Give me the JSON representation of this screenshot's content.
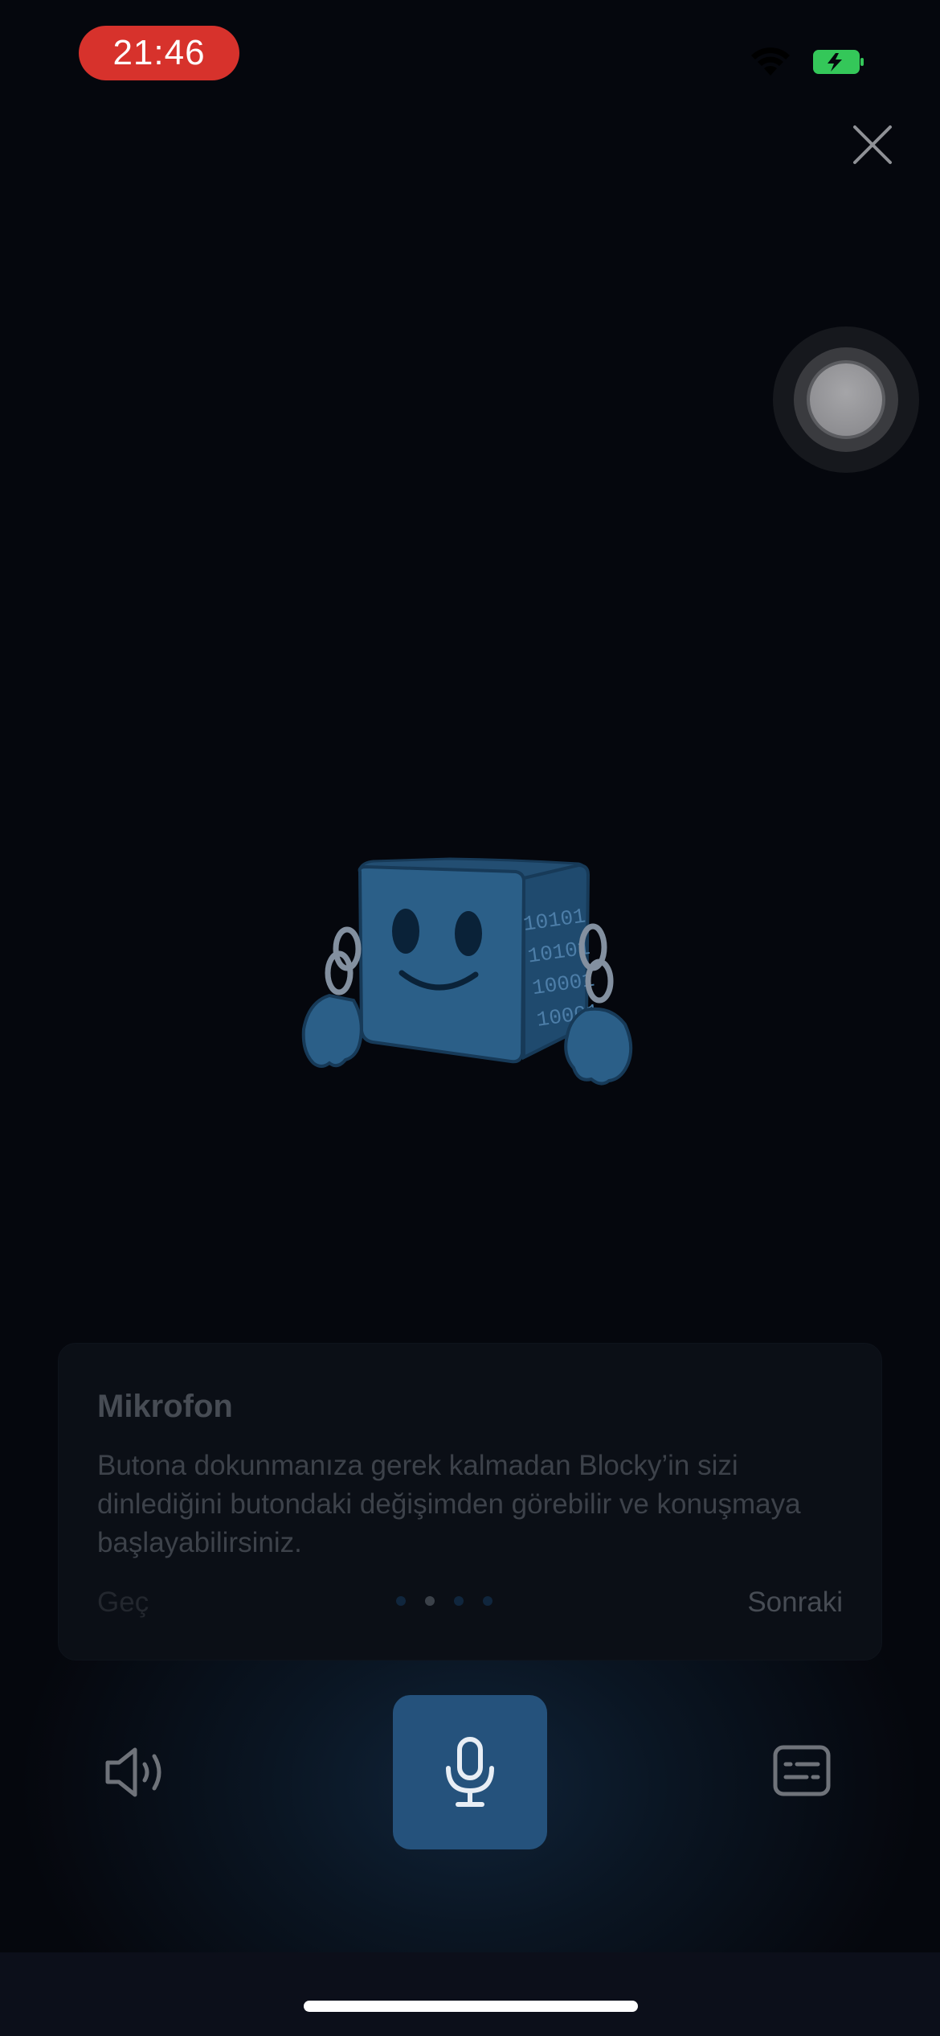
{
  "status_bar": {
    "time": "21:46",
    "wifi_icon": "wifi-icon",
    "battery_icon": "battery-charging-icon"
  },
  "top_bar": {
    "close_icon": "close-icon"
  },
  "assistive_touch": {
    "icon": "assistive-touch-icon"
  },
  "mascot": {
    "name": "Blocky",
    "side_text": [
      "10101",
      "10101",
      "10001",
      "10001"
    ]
  },
  "tutorial_card": {
    "title": "Mikrofon",
    "body": "Butona dokunmanıza gerek kalmadan Blocky’in sizi dinlediğini butondaki değişimden görebilir ve konuşmaya başlayabilirsiniz.",
    "skip_label": "Geç",
    "next_label": "Sonraki",
    "page_count": 4,
    "current_page": 2
  },
  "controls": {
    "speaker_icon": "speaker-icon",
    "mic_icon": "microphone-icon",
    "keyboard_icon": "keyboard-icon"
  },
  "colors": {
    "background": "#05070d",
    "mic_button": "#25527c",
    "time_pill": "#d7322c",
    "battery": "#34c759",
    "mascot_blue": "#2b5f88"
  }
}
